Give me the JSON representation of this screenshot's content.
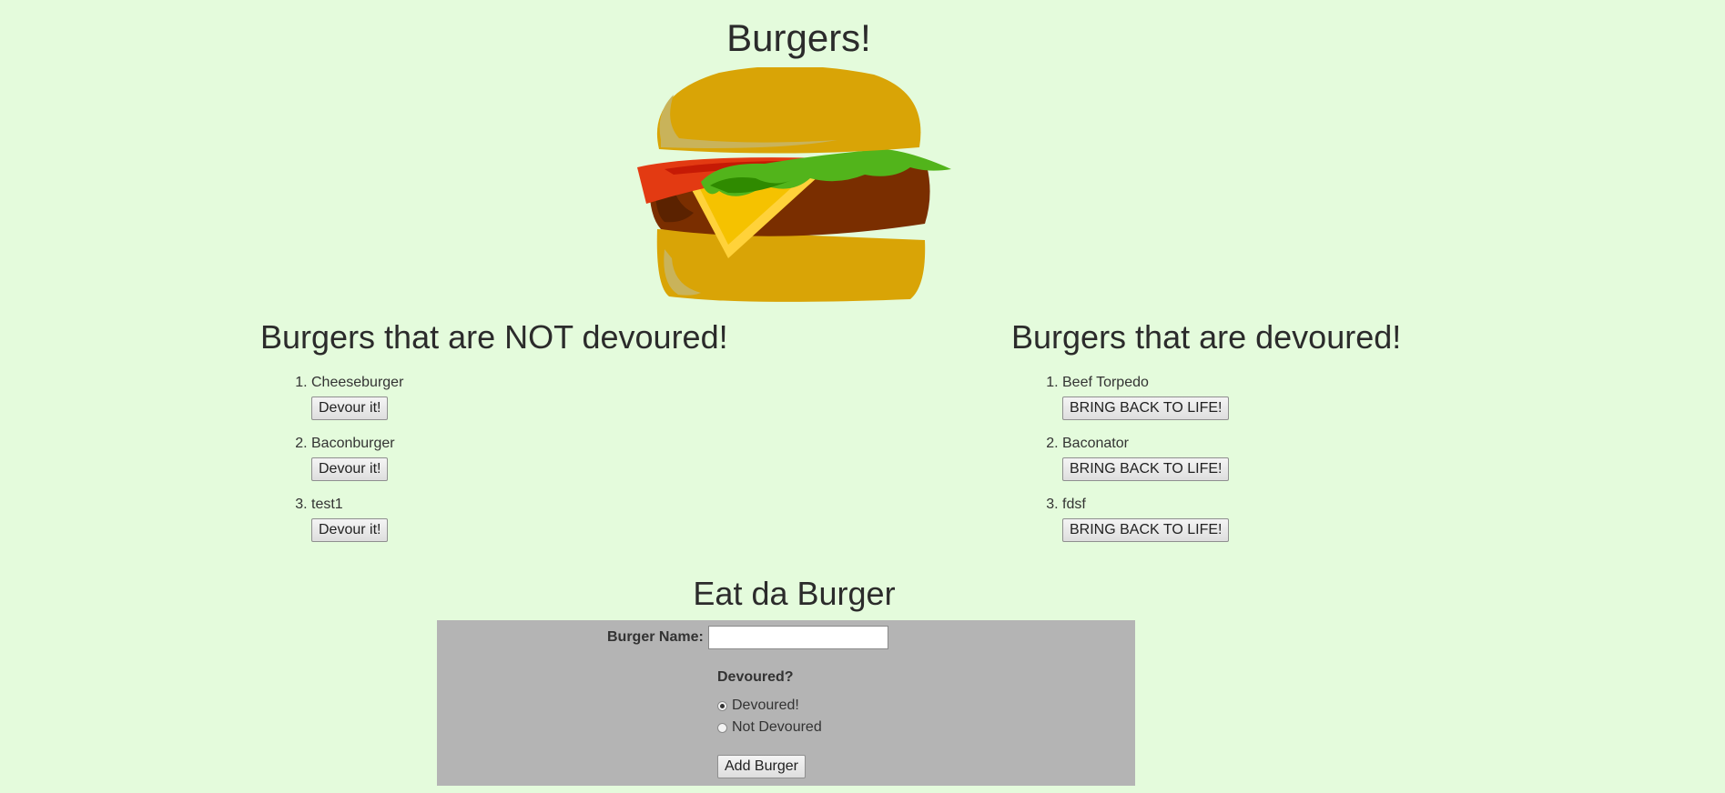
{
  "page": {
    "title": "Burgers!",
    "background": "#e4fbdc"
  },
  "not_devoured": {
    "heading": "Burgers that are NOT devoured!",
    "items": [
      {
        "name": "Cheeseburger",
        "button": "Devour it!"
      },
      {
        "name": "Baconburger",
        "button": "Devour it!"
      },
      {
        "name": "test1",
        "button": "Devour it!"
      }
    ]
  },
  "devoured": {
    "heading": "Burgers that are devoured!",
    "items": [
      {
        "name": "Beef Torpedo",
        "button": "BRING BACK TO LIFE!"
      },
      {
        "name": "Baconator",
        "button": "BRING BACK TO LIFE!"
      },
      {
        "name": "fdsf",
        "button": "BRING BACK TO LIFE!"
      }
    ]
  },
  "form": {
    "heading": "Eat da Burger",
    "name_label": "Burger Name:",
    "name_value": "",
    "devoured_question": "Devoured?",
    "options": [
      {
        "label": "Devoured!",
        "checked": true
      },
      {
        "label": "Not Devoured",
        "checked": false
      }
    ],
    "submit_label": "Add Burger",
    "panel_color": "#b4b4b4"
  }
}
